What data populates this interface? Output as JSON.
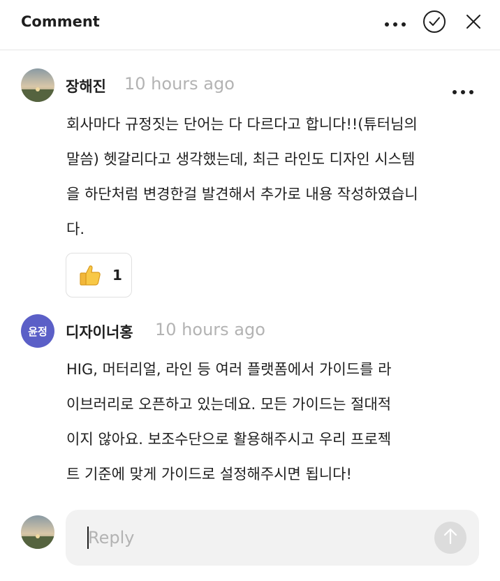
{
  "header": {
    "title": "Comment",
    "icons": {
      "more": "more-horizontal-icon",
      "resolve": "check-circle-icon",
      "close": "close-icon"
    }
  },
  "comments": [
    {
      "author": "장해진",
      "timestamp": "10 hours ago",
      "avatar": "landscape-photo",
      "lines": [
        "회사마다 규정짓는 단어는 다 다르다고 합니다!!(튜터님의",
        "말씀) 헷갈리다고 생각했는데, 최근 라인도 디자인 시스템",
        "을 하단처럼 변경한걸 발견해서 추가로 내용 작성하였습니",
        "다."
      ],
      "reaction": {
        "emoji": "thumbs-up-icon",
        "count": "1"
      }
    },
    {
      "author": "디자이너홍",
      "timestamp": "10 hours ago",
      "avatar_initials": "윤정",
      "avatar_color": "#5b5fc7",
      "lines": [
        "HIG, 머터리얼, 라인 등 여러 플랫폼에서 가이드를 라",
        "이브러리로 오픈하고 있는데요. 모든 가이드는 절대적",
        "이지 않아요. 보조수단으로 활용해주시고 우리 프로젝",
        "트 기준에 맞게 가이드로 설정해주시면 됩니다!"
      ]
    }
  ],
  "reply": {
    "placeholder": "Reply",
    "value": "",
    "send_icon": "arrow-up-icon",
    "avatar": "landscape-photo"
  }
}
